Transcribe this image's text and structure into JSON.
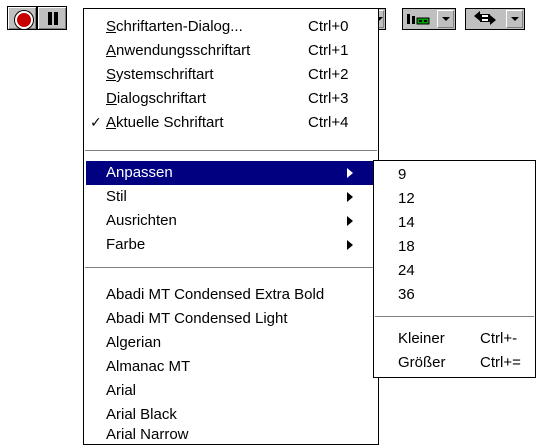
{
  "toolbar": {
    "record_icon": "record-icon",
    "pause_icon": "pause-icon",
    "view_icon": "bar-view-icon",
    "sync_icon": "sync-arrows-icon",
    "colors": {
      "face": "#c0c0c0",
      "record": "#c80000",
      "view_green": "#00a000"
    }
  },
  "font_menu": {
    "dialog_items": [
      {
        "mnemonic": "S",
        "rest": "chriftarten-Dialog...",
        "shortcut": "Ctrl+0"
      },
      {
        "mnemonic": "A",
        "rest": "nwendungsschriftart",
        "shortcut": "Ctrl+1"
      },
      {
        "mnemonic": "S",
        "rest": "ystemschriftart",
        "shortcut": "Ctrl+2"
      },
      {
        "mnemonic": "D",
        "rest": "ialogschriftart",
        "shortcut": "Ctrl+3"
      },
      {
        "mnemonic": "A",
        "rest": "ktuelle Schriftart",
        "shortcut": "Ctrl+4",
        "check": "✓"
      }
    ],
    "submenu_items": [
      {
        "label": "Anpassen",
        "highlighted": true
      },
      {
        "label": "Stil"
      },
      {
        "label": "Ausrichten"
      },
      {
        "label": "Farbe"
      }
    ],
    "fonts": [
      "Abadi MT Condensed Extra Bold",
      "Abadi MT Condensed Light",
      "Algerian",
      "Almanac MT",
      "Arial",
      "Arial Black",
      "Arial Narrow"
    ],
    "highlight_color": "#000080"
  },
  "size_submenu": {
    "sizes": [
      "9",
      "12",
      "14",
      "18",
      "24",
      "36"
    ],
    "actions": [
      {
        "label": "Kleiner",
        "shortcut": "Ctrl+-"
      },
      {
        "label": "Größer",
        "shortcut": "Ctrl+="
      }
    ]
  }
}
